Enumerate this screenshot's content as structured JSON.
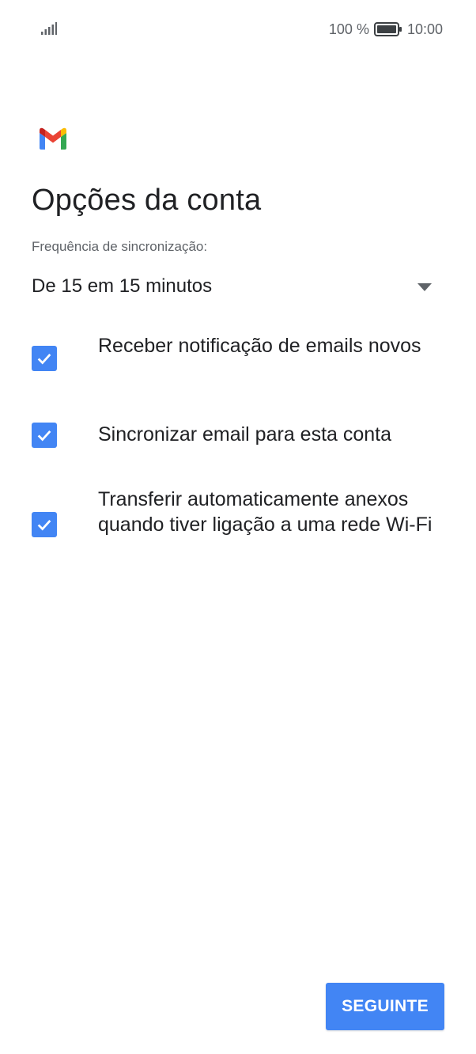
{
  "status_bar": {
    "signal_icon": "signal-bars-icon",
    "battery_percent": "100 %",
    "battery_icon": "battery-full-icon",
    "time": "10:00"
  },
  "header": {
    "logo_icon": "gmail-logo-icon",
    "title": "Opções da conta"
  },
  "sync": {
    "label": "Frequência de sincronização:",
    "selected_value": "De 15 em 15 minutos",
    "dropdown_icon": "dropdown-arrow-icon"
  },
  "options": [
    {
      "label": "Receber notificação de emails novos",
      "checked": true
    },
    {
      "label": "Sincronizar email para esta conta",
      "checked": true
    },
    {
      "label": "Transferir automaticamente anexos quando tiver ligação a uma rede Wi-Fi",
      "checked": true
    }
  ],
  "footer": {
    "next_label": "SEGUINTE"
  },
  "colors": {
    "accent": "#4285f4",
    "text_primary": "#202124",
    "text_secondary": "#5f6368",
    "background": "#ffffff"
  }
}
